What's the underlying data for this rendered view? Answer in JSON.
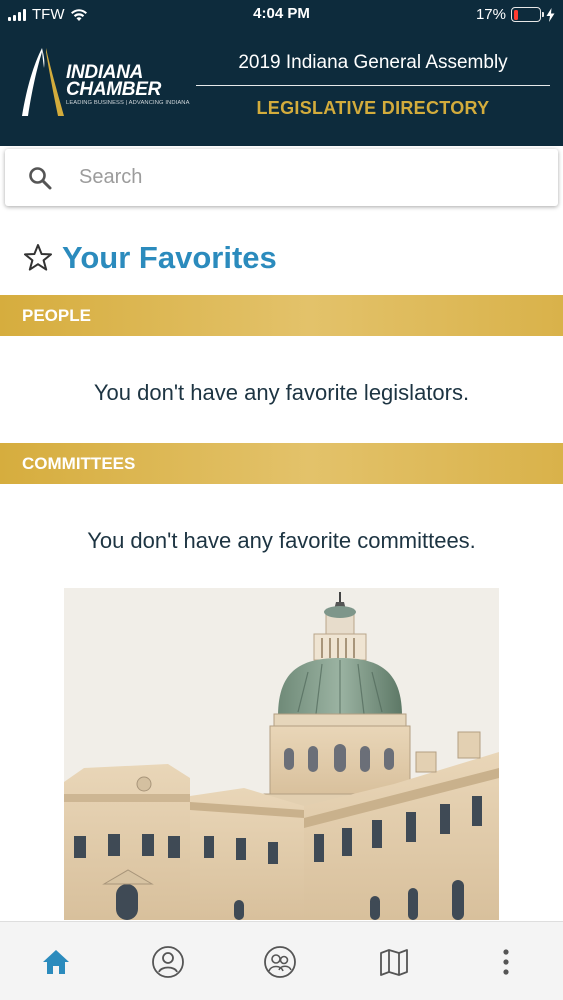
{
  "status_bar": {
    "carrier": "TFW",
    "time": "4:04 PM",
    "battery": "17%",
    "battery_level": 0.17,
    "signal_icon": "signal-bars-icon",
    "wifi_icon": "wifi-icon",
    "charging_icon": "bolt-icon"
  },
  "header": {
    "logo_line1": "INDIANA",
    "logo_line2": "CHAMBER",
    "logo_tagline": "LEADING BUSINESS | ADVANCING INDIANA",
    "title": "2019 Indiana General Assembly",
    "subtitle": "LEGISLATIVE DIRECTORY",
    "colors": {
      "background": "#0d2b3c",
      "accent": "#d3ac3c"
    }
  },
  "search": {
    "placeholder": "Search",
    "value": "",
    "icon": "search-icon"
  },
  "favorites": {
    "title": "Your Favorites",
    "icon": "star-outline-icon",
    "title_color": "#2b8bbd",
    "sections": [
      {
        "label": "PEOPLE",
        "empty_message": "You don't have any favorite legislators."
      },
      {
        "label": "COMMITTEES",
        "empty_message": "You don't have any favorite committees."
      }
    ]
  },
  "image": {
    "subject": "capitol-building-image"
  },
  "tab_bar": {
    "active_index": 0,
    "active_color": "#2b8bbd",
    "tabs": [
      {
        "icon": "home-icon"
      },
      {
        "icon": "person-icon"
      },
      {
        "icon": "people-group-icon"
      },
      {
        "icon": "map-icon"
      },
      {
        "icon": "more-vertical-icon"
      }
    ]
  }
}
